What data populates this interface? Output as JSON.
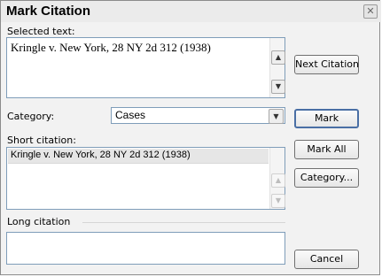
{
  "dialog": {
    "title": "Mark Citation",
    "close_icon": "close-x-icon"
  },
  "selected_text": {
    "label": "Selected text:",
    "value": "Kringle v. New York, 28 NY 2d 312 (1938)"
  },
  "category": {
    "label": "Category:",
    "value": "Cases"
  },
  "short_citation": {
    "label": "Short citation:",
    "value": "Kringle v. New York, 28 NY 2d 312 (1938)"
  },
  "long_citation": {
    "label": "Long citation",
    "value": ""
  },
  "buttons": {
    "next_citation": "Next Citation",
    "mark": "Mark",
    "mark_all": "Mark All",
    "category": "Category...",
    "cancel": "Cancel"
  },
  "icons": {
    "scroll_up": "scroll-up-arrow-icon",
    "scroll_down": "scroll-down-arrow-icon",
    "dropdown": "dropdown-arrow-icon"
  }
}
